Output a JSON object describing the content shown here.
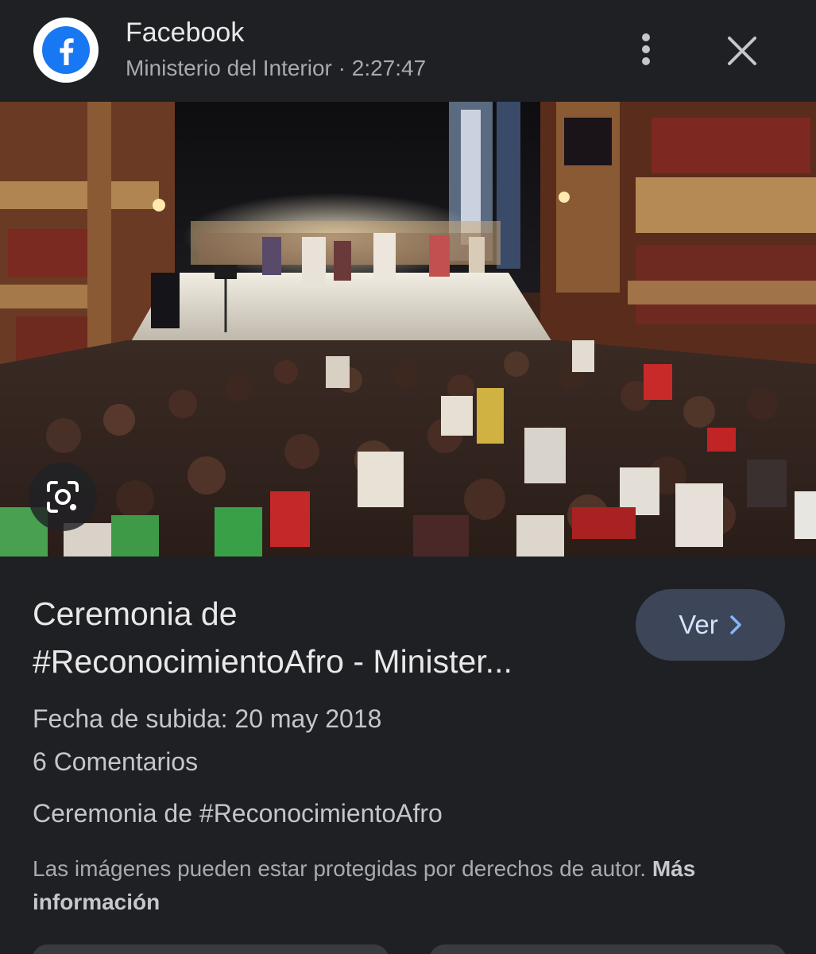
{
  "header": {
    "source_name": "Facebook",
    "source_subtitle": "Ministerio del Interior · 2:27:47",
    "logo_icon": "facebook-logo-icon",
    "more_icon": "more-vertical-icon",
    "close_icon": "close-icon"
  },
  "image": {
    "lens_icon": "google-lens-icon"
  },
  "result": {
    "title_line1": "Ceremonia de",
    "title_line2": "#ReconocimientoAfro - Minister...",
    "visit_label": "Ver",
    "visit_icon": "chevron-right-icon",
    "upload_date": "Fecha de subida: 20 may 2018",
    "comments": "6 Comentarios",
    "description": "Ceremonia de #ReconocimientoAfro",
    "copyright_text": "Las imágenes pueden estar protegidas por derechos de autor.",
    "copyright_link": "Más información"
  },
  "colors": {
    "background": "#1f2023",
    "facebook_blue": "#1877f2",
    "button_bg": "#3c4658",
    "button_text": "#d7e3fc",
    "chevron": "#8ab4f8"
  }
}
